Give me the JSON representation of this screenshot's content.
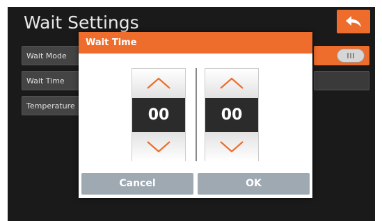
{
  "header": {
    "title": "Wait Settings",
    "back_icon": "back-arrow-icon"
  },
  "settings": {
    "rows": [
      {
        "label": "Wait Mode"
      },
      {
        "label": "Wait Time"
      },
      {
        "label": "Temperature"
      }
    ]
  },
  "dialog": {
    "title": "Wait Time",
    "spinners": [
      {
        "value": "00",
        "up_icon": "chevron-up-icon",
        "down_icon": "chevron-down-icon"
      },
      {
        "value": "00",
        "up_icon": "chevron-up-icon",
        "down_icon": "chevron-down-icon"
      }
    ],
    "cancel_label": "Cancel",
    "ok_label": "OK"
  },
  "colors": {
    "accent": "#ee6d2c",
    "background": "#1a1a1a",
    "button_gray": "#9fa9b2"
  }
}
